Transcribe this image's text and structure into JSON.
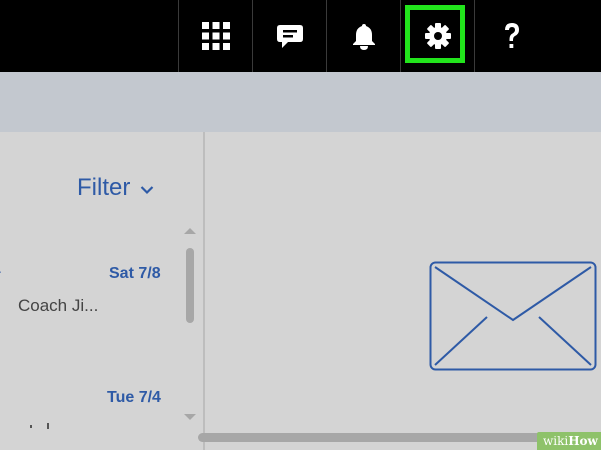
{
  "topbar": {
    "buttons": [
      {
        "id": "app-launcher",
        "icon": "waffle-grid-icon"
      },
      {
        "id": "chat",
        "icon": "chat-bubble-icon"
      },
      {
        "id": "notifications",
        "icon": "bell-icon"
      },
      {
        "id": "settings",
        "icon": "gear-icon",
        "highlighted": true
      },
      {
        "id": "help",
        "icon": "question-mark-icon"
      }
    ],
    "highlight_color": "#22e51c"
  },
  "message_list": {
    "filter_label": "Filter",
    "messages": [
      {
        "date": "Sat 7/8",
        "sender": "Coach Ji..."
      },
      {
        "date": "Tue 7/4",
        "sender": ""
      }
    ]
  },
  "reading_pane": {
    "placeholder_icon": "envelope-icon"
  },
  "colors": {
    "accent": "#2e5aa6",
    "topbar": "#000000",
    "subbar": "#c3c8cf",
    "background": "#d4d4d4"
  },
  "watermark": {
    "prefix": "wiki",
    "suffix": "How"
  }
}
